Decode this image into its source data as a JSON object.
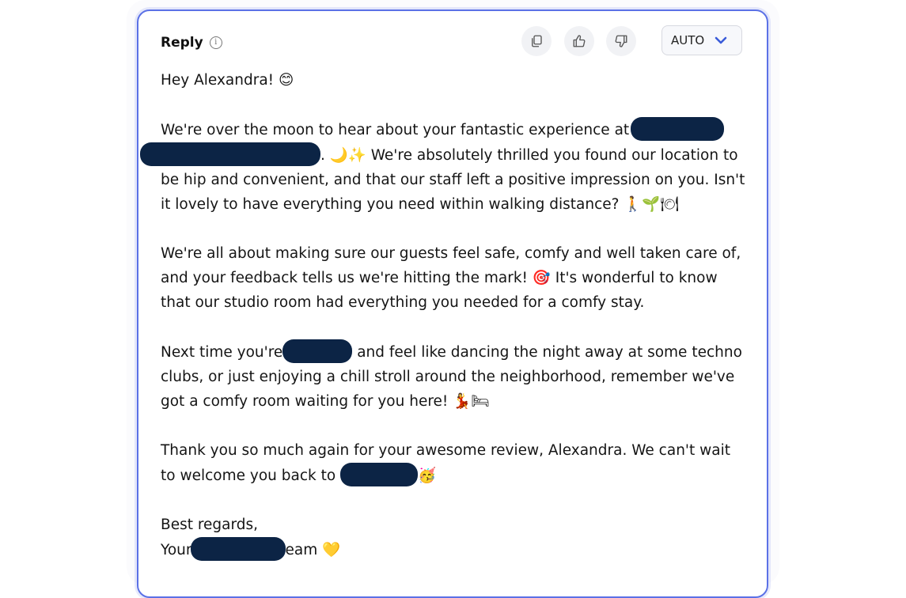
{
  "header": {
    "label": "Reply",
    "info_icon": "info-icon"
  },
  "toolbar": {
    "copy_icon": "copy-icon",
    "like_icon": "thumbs-up-icon",
    "dislike_icon": "thumbs-down-icon",
    "mode_select": {
      "value": "AUTO",
      "icon": "chevron-down-icon"
    }
  },
  "colors": {
    "accent": "#5b71e6",
    "redaction": "#0c2445",
    "chevron": "#3a5bd9"
  },
  "reply": {
    "greeting": "Hey Alexandra! 😊",
    "p1_a": "We're over the moon to hear about your fantastic experience at",
    "p1_b": ". 🌙✨ We're absolutely thrilled you found our location to be hip and convenient, and that our staff left a positive impression on you. Isn't it lovely to have everything you need within walking distance? 🚶🌱🍽",
    "p2": "We're all about making sure our guests feel safe, comfy and well taken care of, and your feedback tells us we're hitting the mark! 🎯 It's wonderful to know that our studio room had everything you needed for a comfy stay.",
    "p3_a": "Next time you're",
    "p3_b": "and feel like dancing the night away at some techno clubs, or just enjoying a chill stroll around the neighborhood, remember we've got a comfy room waiting for you here! 💃🛏",
    "p4_a": "Thank you so much again for your awesome review, Alexandra. We can't wait to welcome you back to",
    "p4_b": "🥳",
    "signoff": "Best regards,",
    "sign_a": "Your",
    "sign_b": "eam 💛"
  }
}
